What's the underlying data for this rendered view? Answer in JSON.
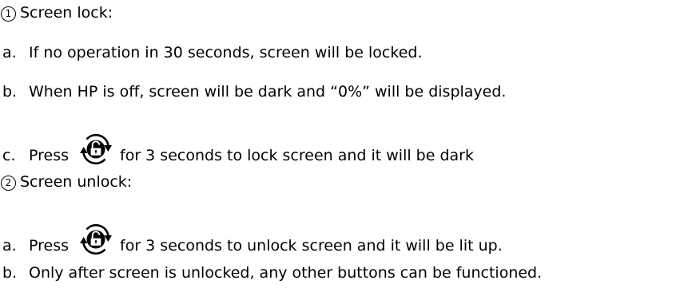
{
  "sections": [
    {
      "number": "1",
      "title": "Screen lock:",
      "items": [
        {
          "marker": "a.",
          "text": "If no operation in 30 seconds, screen will be locked."
        },
        {
          "marker": "b.",
          "text": "When HP is off, screen will be dark and “0%” will be displayed."
        },
        {
          "marker": "c.",
          "before": "Press",
          "icon": "lock-rotate-icon",
          "after": "for 3 seconds to lock screen and it will be dark"
        }
      ]
    },
    {
      "number": "2",
      "title": "Screen unlock:",
      "items": [
        {
          "marker": "a.",
          "before": "Press",
          "icon": "lock-rotate-icon",
          "after": "for 3 seconds to unlock screen and it will be lit up."
        },
        {
          "marker": "b.",
          "text": "Only after screen is unlocked, any other buttons can be functioned."
        }
      ]
    }
  ]
}
